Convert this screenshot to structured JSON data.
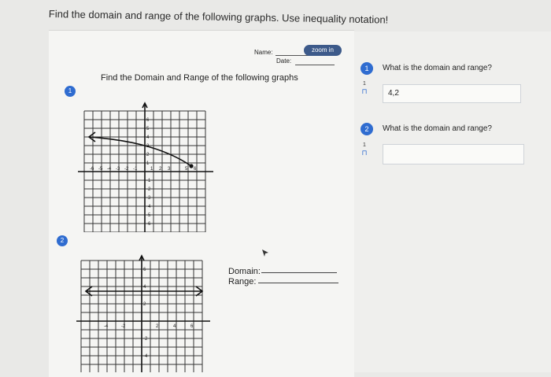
{
  "header": {
    "title": "Find the domain and range of the following graphs. Use inequality notation!"
  },
  "worksheet": {
    "name_label": "Name:",
    "date_label": "Date:",
    "zoom_label": "zoom in",
    "title": "Find the Domain and Range of the following graphs",
    "q1_badge": "1",
    "q2_badge": "2",
    "domain_label": "Domain:",
    "range_label": "Range:"
  },
  "graph1": {
    "y_ticks": [
      "6",
      "5",
      "4",
      "3",
      "2",
      "1",
      "-1",
      "-2",
      "-3",
      "-4",
      "-5",
      "-6"
    ],
    "x_ticks": [
      "-6",
      "-5",
      "-4",
      "-3",
      "-2",
      "-1",
      "1",
      "2",
      "3",
      "5",
      "6"
    ]
  },
  "graph2": {
    "y_ticks": [
      "6",
      "4",
      "2",
      "-2",
      "-4"
    ],
    "x_ticks": [
      "-4",
      "-2",
      "2",
      "4",
      "6"
    ]
  },
  "questions": [
    {
      "number": "1",
      "text": "What is the domain and range?",
      "answer": "4,2",
      "flag_number": "1"
    },
    {
      "number": "2",
      "text": "What is the domain and range?",
      "answer": "",
      "flag_number": "1"
    }
  ],
  "colors": {
    "accent": "#2f6cd0",
    "zoom_button": "#3d5a8a"
  },
  "icons": {
    "flag": "flag-icon",
    "arrow": "arrow-icon"
  }
}
